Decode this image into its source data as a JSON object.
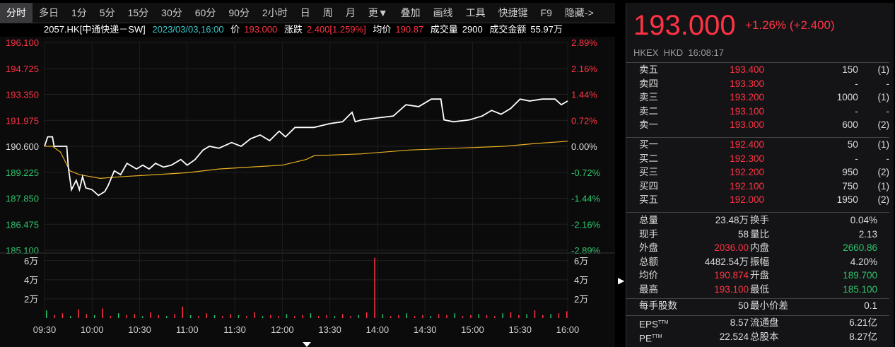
{
  "toolbar": [
    "分时",
    "多日",
    "1分",
    "5分",
    "15分",
    "30分",
    "60分",
    "90分",
    "2小时",
    "日",
    "周",
    "月",
    "更▼",
    "叠加",
    "画线",
    "工具",
    "快捷键",
    "F9",
    "隐藏->"
  ],
  "info": {
    "symbol": "2057.HK[中通快递－SW]",
    "datetime": "2023/03/03,16:00",
    "price_label": "价",
    "price": "193.000",
    "change_label": "涨跌",
    "change": "2.400[1.259%]",
    "avg_label": "均价",
    "avg": "190.87",
    "vol_label": "成交量",
    "vol": "2900",
    "amount_label": "成交金额",
    "amount": "55.97万"
  },
  "colors": {
    "up": "#ff3344",
    "down": "#2fc36c",
    "price_line": "#ffffff",
    "avg_line": "#e8b020"
  },
  "chart_data": {
    "type": "line",
    "x_ticks": [
      "09:30",
      "10:00",
      "10:30",
      "11:00",
      "11:30",
      "12:00",
      "13:30",
      "14:00",
      "14:30",
      "15:00",
      "15:30",
      "16:00"
    ],
    "y_left": [
      "196.100",
      "194.725",
      "193.350",
      "191.975",
      "190.600",
      "189.225",
      "187.850",
      "186.475",
      "185.100"
    ],
    "y_right": [
      "2.89%",
      "2.16%",
      "1.44%",
      "0.72%",
      "0.00%",
      "-0.72%",
      "-1.44%",
      "-2.16%",
      "-2.89%"
    ],
    "ylim": [
      185.1,
      196.1
    ],
    "vol_ticks": [
      "6万",
      "4万",
      "2万"
    ],
    "vol_max": 6.5,
    "price_series": [
      [
        0,
        190.6
      ],
      [
        2,
        191.1
      ],
      [
        5,
        191.1
      ],
      [
        6,
        190.6
      ],
      [
        14,
        190.6
      ],
      [
        15,
        189.5
      ],
      [
        17,
        188.3
      ],
      [
        20,
        188.8
      ],
      [
        22,
        188.3
      ],
      [
        24,
        189.0
      ],
      [
        26,
        188.4
      ],
      [
        30,
        188.3
      ],
      [
        34,
        188.0
      ],
      [
        38,
        188.2
      ],
      [
        40,
        188.5
      ],
      [
        44,
        189.3
      ],
      [
        48,
        189.1
      ],
      [
        52,
        189.7
      ],
      [
        58,
        189.4
      ],
      [
        62,
        189.6
      ],
      [
        66,
        189.4
      ],
      [
        70,
        189.7
      ],
      [
        75,
        189.5
      ],
      [
        80,
        189.6
      ],
      [
        86,
        189.9
      ],
      [
        90,
        189.6
      ],
      [
        95,
        189.9
      ],
      [
        100,
        190.4
      ],
      [
        104,
        190.6
      ],
      [
        110,
        190.5
      ],
      [
        118,
        190.8
      ],
      [
        124,
        190.6
      ],
      [
        130,
        191.0
      ],
      [
        136,
        191.2
      ],
      [
        142,
        190.9
      ],
      [
        148,
        191.4
      ],
      [
        152,
        191.1
      ],
      [
        158,
        191.6
      ],
      [
        165,
        191.6
      ],
      [
        170,
        191.6
      ],
      [
        180,
        191.8
      ],
      [
        188,
        191.9
      ],
      [
        194,
        192.4
      ],
      [
        196,
        191.9
      ],
      [
        200,
        192.0
      ],
      [
        210,
        192.1
      ],
      [
        220,
        192.2
      ],
      [
        228,
        192.8
      ],
      [
        236,
        192.7
      ],
      [
        244,
        193.1
      ],
      [
        250,
        193.1
      ],
      [
        252,
        192.0
      ],
      [
        258,
        191.9
      ],
      [
        268,
        192.0
      ],
      [
        276,
        192.2
      ],
      [
        282,
        192.5
      ],
      [
        288,
        192.3
      ],
      [
        294,
        192.6
      ],
      [
        300,
        193.1
      ],
      [
        306,
        193.0
      ],
      [
        314,
        193.1
      ],
      [
        322,
        193.1
      ],
      [
        326,
        192.8
      ],
      [
        330,
        193.0
      ]
    ],
    "avg_series": [
      [
        0,
        190.6
      ],
      [
        5,
        190.6
      ],
      [
        10,
        190.3
      ],
      [
        16,
        189.3
      ],
      [
        22,
        189.1
      ],
      [
        35,
        188.9
      ],
      [
        50,
        189.0
      ],
      [
        70,
        189.1
      ],
      [
        90,
        189.2
      ],
      [
        110,
        189.4
      ],
      [
        130,
        189.5
      ],
      [
        150,
        189.6
      ],
      [
        165,
        189.9
      ],
      [
        170,
        190.1
      ],
      [
        200,
        190.2
      ],
      [
        230,
        190.4
      ],
      [
        260,
        190.5
      ],
      [
        290,
        190.6
      ],
      [
        310,
        190.75
      ],
      [
        330,
        190.87
      ]
    ],
    "volume": [
      0.8,
      0.3,
      0.5,
      0.2,
      0.9,
      0.4,
      0.3,
      1.0,
      0.2,
      0.5,
      0.3,
      0.4,
      0.2,
      0.6,
      0.3,
      0.2,
      0.4,
      1.2,
      0.3,
      0.2,
      0.5,
      0.3,
      0.2,
      0.4,
      0.3,
      0.2,
      0.6,
      0.2,
      0.3,
      0.2,
      0.4,
      0.2,
      0.3,
      0.5,
      0.2,
      0.3,
      0.2,
      0.4,
      0.2,
      0.3,
      0.6,
      6.3,
      0.4,
      0.2,
      0.3,
      0.5,
      0.2,
      0.3,
      0.2,
      0.4,
      0.3,
      0.5,
      0.2,
      0.3,
      0.4,
      0.3,
      0.2,
      0.5,
      0.6,
      0.3,
      0.4,
      0.8,
      0.3,
      0.4,
      0.5,
      0.7
    ]
  },
  "quote": {
    "price": "193.000",
    "change": "+1.26%  (+2.400)",
    "exchange": "HKEX",
    "currency": "HKD",
    "time": "16:08:17"
  },
  "asks": [
    [
      "卖五",
      "193.400",
      "150",
      "(1)"
    ],
    [
      "卖四",
      "193.300",
      "-",
      "-"
    ],
    [
      "卖三",
      "193.200",
      "1000",
      "(1)"
    ],
    [
      "卖二",
      "193.100",
      "-",
      "-"
    ],
    [
      "卖一",
      "193.000",
      "600",
      "(2)"
    ]
  ],
  "bids": [
    [
      "买一",
      "192.400",
      "50",
      "(1)"
    ],
    [
      "买二",
      "192.300",
      "-",
      "-"
    ],
    [
      "买三",
      "192.200",
      "950",
      "(2)"
    ],
    [
      "买四",
      "192.100",
      "750",
      "(1)"
    ],
    [
      "买五",
      "192.000",
      "1950",
      "(2)"
    ]
  ],
  "stats": [
    [
      "总量",
      "23.48万",
      "换手",
      "0.04%"
    ],
    [
      "现手",
      "58",
      "量比",
      "2.13"
    ],
    [
      "外盘",
      "2036.00",
      "内盘",
      "2660.86"
    ],
    [
      "总额",
      "4482.54万",
      "振幅",
      "4.20%"
    ],
    [
      "均价",
      "190.874",
      "开盘",
      "189.700"
    ],
    [
      "最高",
      "193.100",
      "最低",
      "185.100"
    ]
  ],
  "lot": [
    [
      "每手股数",
      "50",
      "最小价差",
      "0.1"
    ]
  ],
  "fund": [
    [
      "EPS",
      "TTM",
      "8.57",
      "流通盘",
      "6.21亿"
    ],
    [
      "PE",
      "TTM",
      "22.524",
      "总股本",
      "8.27亿"
    ]
  ]
}
